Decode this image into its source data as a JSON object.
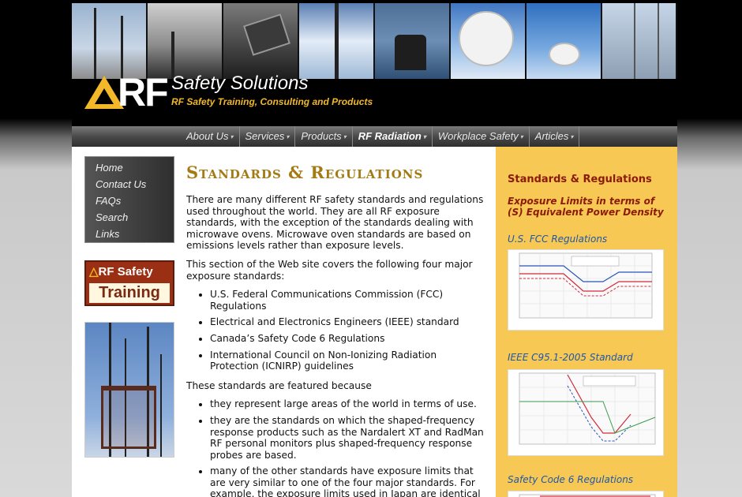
{
  "header": {
    "logo_text": "RF",
    "company": "Safety Solutions",
    "tagline": "RF Safety Training, Consulting and Products"
  },
  "nav": {
    "items": [
      {
        "label": "About Us",
        "has_menu": true
      },
      {
        "label": "Services",
        "has_menu": true
      },
      {
        "label": "Products",
        "has_menu": true
      },
      {
        "label": "RF Radiation",
        "has_menu": true,
        "active": true
      },
      {
        "label": "Workplace Safety",
        "has_menu": true
      },
      {
        "label": "Articles",
        "has_menu": true
      }
    ]
  },
  "sidebar": {
    "links": [
      "Home",
      "Contact Us",
      "FAQs",
      "Search",
      "Links"
    ],
    "training_banner": {
      "line1": "RF Safety",
      "line2": "Training"
    }
  },
  "main": {
    "title": "Standards & Regulations",
    "intro": "There are many different RF safety standards and regulations used throughout the world. They are all RF exposure standards, with the exception of the standards dealing with microwave ovens. Microwave oven standards are based on emissions levels rather than exposure levels.",
    "section_intro": "This section of the Web site covers the following four major exposure standards:",
    "standards": [
      "U.S. Federal Communications Commission (FCC) Regulations",
      "Electrical and Electronics Engineers (IEEE) standard",
      "Canada’s Safety Code 6 Regulations",
      "International Council on Non-Ionizing Radiation Protection (ICNIRP) guidelines"
    ],
    "featured_intro": "These standards are featured because",
    "reasons": [
      "they represent large areas of the world in terms of use.",
      "they are the standards on which the shaped-frequency response products such as the Nardalert XT and RadMan RF personal monitors plus shaped-frequency response probes are based.",
      "many of the other standards have exposure limits that are very similar to one of the four major standards. For example, the exposure limits used in Japan are identical to"
    ]
  },
  "right_panel": {
    "title": "Standards & Regulations",
    "subtitle": "Exposure Limits in terms of (S) Equivalent Power Density",
    "links": [
      "U.S. FCC Regulations",
      "IEEE C95.1-2005 Standard",
      "Safety Code 6 Regulations"
    ]
  },
  "colors": {
    "accent_gold": "#f2b829",
    "title_gold": "#a37a13",
    "panel_bg": "#f7c853",
    "panel_heading": "#8b1a0a",
    "link_blue": "#1f57a8"
  }
}
